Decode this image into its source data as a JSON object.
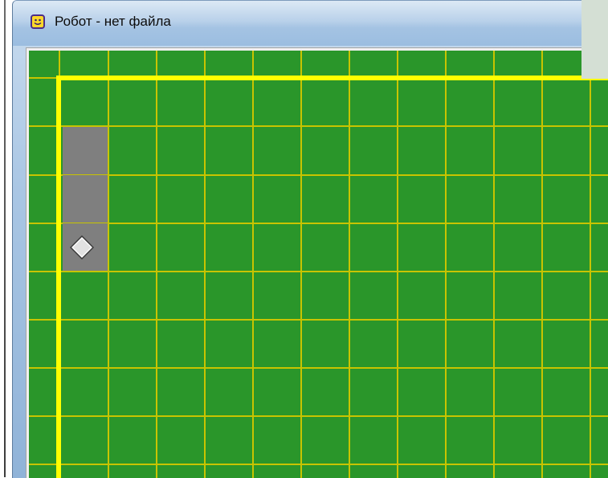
{
  "window": {
    "title": "Робот - нет файла",
    "icon": "robot-smiley-icon"
  },
  "field": {
    "background_color": "#2a962a",
    "grid_color": "#c8c400",
    "wall_color": "#ffff00",
    "painted_color": "#7f7f7f",
    "painted_cells": [
      {
        "col": 1,
        "row": 1
      },
      {
        "col": 1,
        "row": 2
      },
      {
        "col": 1,
        "row": 3
      }
    ],
    "robot": {
      "col": 1,
      "row": 3,
      "icon": "robot-diamond-icon"
    },
    "walls": [
      "top-border",
      "left-border"
    ]
  }
}
